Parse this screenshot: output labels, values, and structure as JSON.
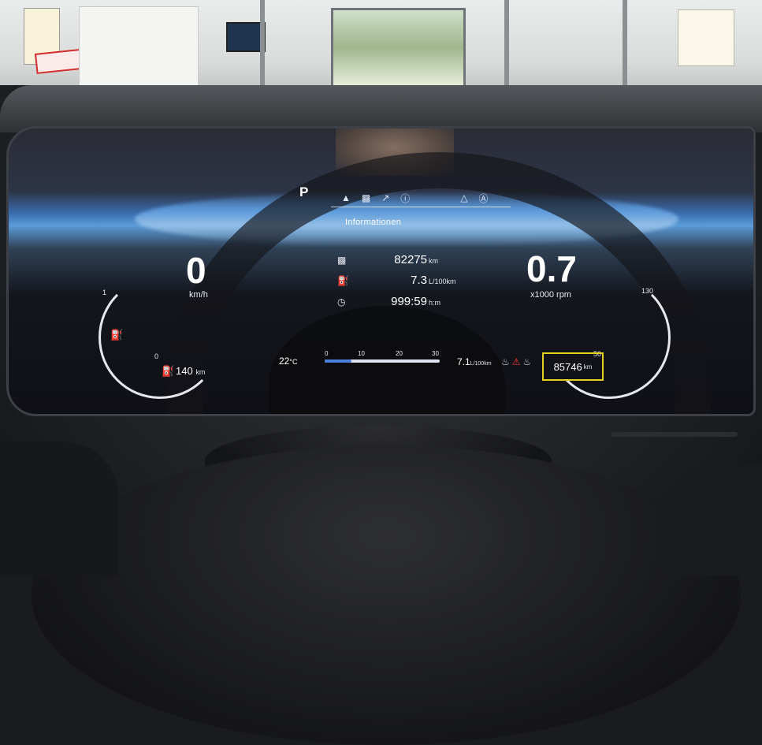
{
  "cluster": {
    "gear": "P",
    "header_icons": [
      "lane-icon",
      "car-icon",
      "route-icon",
      "info-icon",
      "assist-icon",
      "auto-hold-icon"
    ],
    "title": "Informationen",
    "speed": {
      "value": "0",
      "unit": "km/h"
    },
    "rpm": {
      "value": "0.7",
      "unit": "x1000 rpm"
    },
    "trip": [
      {
        "icon": "car-odometer-icon",
        "value": "82275",
        "unit": "km"
      },
      {
        "icon": "fuel-pump-icon",
        "value": "7.3",
        "unit": "L/100km"
      },
      {
        "icon": "clock-icon",
        "value": "999:59",
        "unit": "h:m"
      }
    ],
    "range": {
      "value": "140",
      "unit": "km"
    },
    "outside_temp": {
      "value": "22",
      "unit": "°C"
    },
    "consumption_scale": {
      "labels": [
        "0",
        "10",
        "20",
        "30"
      ],
      "current": "7.1",
      "unit": "L/100km",
      "fill_fraction": 0.23
    },
    "odometer": {
      "value": "85746",
      "unit": "km"
    },
    "fuel_gauge_ticks": {
      "full": "1",
      "empty": "0"
    },
    "speed_gauge_ticks": {
      "top": "130",
      "bottom": "50"
    }
  },
  "colors": {
    "highlight_box": "#e4d01e",
    "seatbelt_alert": "#ff3a3a",
    "scale_fill": "#4f7fdc"
  }
}
